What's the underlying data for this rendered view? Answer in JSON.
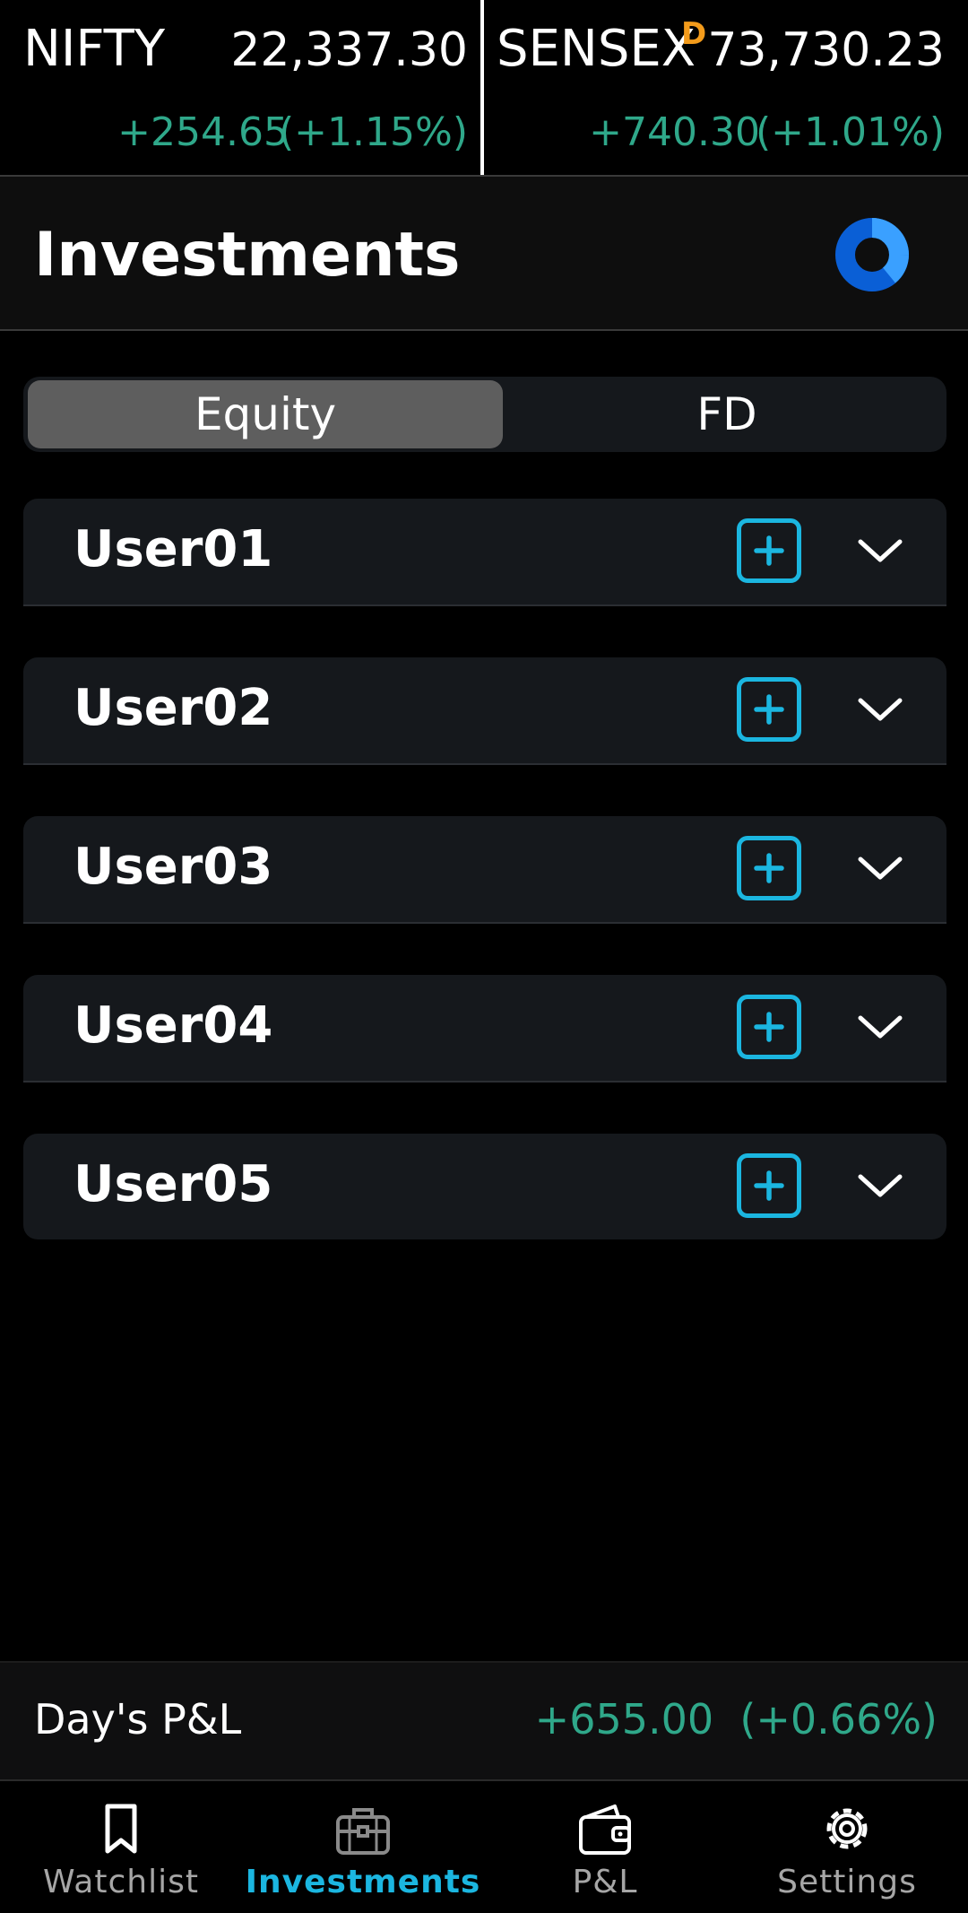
{
  "ticker": {
    "nifty": {
      "name": "NIFTY",
      "value": "22,337.30",
      "change": "+254.65",
      "change_pct": "(+1.15%)"
    },
    "sensex": {
      "name": "SENSEX",
      "badge": "D",
      "value": "73,730.23",
      "change": "+740.30",
      "change_pct": "(+1.01%)"
    }
  },
  "header": {
    "title": "Investments",
    "icon": "ring-progress-icon"
  },
  "tabs": [
    {
      "label": "Equity",
      "active": true
    },
    {
      "label": "FD",
      "active": false
    }
  ],
  "users": [
    {
      "label": "User01"
    },
    {
      "label": "User02"
    },
    {
      "label": "User03"
    },
    {
      "label": "User04"
    },
    {
      "label": "User05"
    }
  ],
  "pl": {
    "label": "Day's P&L",
    "value": "+655.00",
    "pct": "(+0.66%)"
  },
  "bottom_nav": [
    {
      "label": "Watchlist",
      "icon": "bookmark-icon",
      "active": false
    },
    {
      "label": "Investments",
      "icon": "briefcase-icon",
      "active": true
    },
    {
      "label": "P&L",
      "icon": "wallet-icon",
      "active": false
    },
    {
      "label": "Settings",
      "icon": "gear-icon",
      "active": false
    }
  ],
  "colors": {
    "accent": "#1bb6e0",
    "positive": "#2fa88a",
    "badge": "#f39b1b"
  }
}
